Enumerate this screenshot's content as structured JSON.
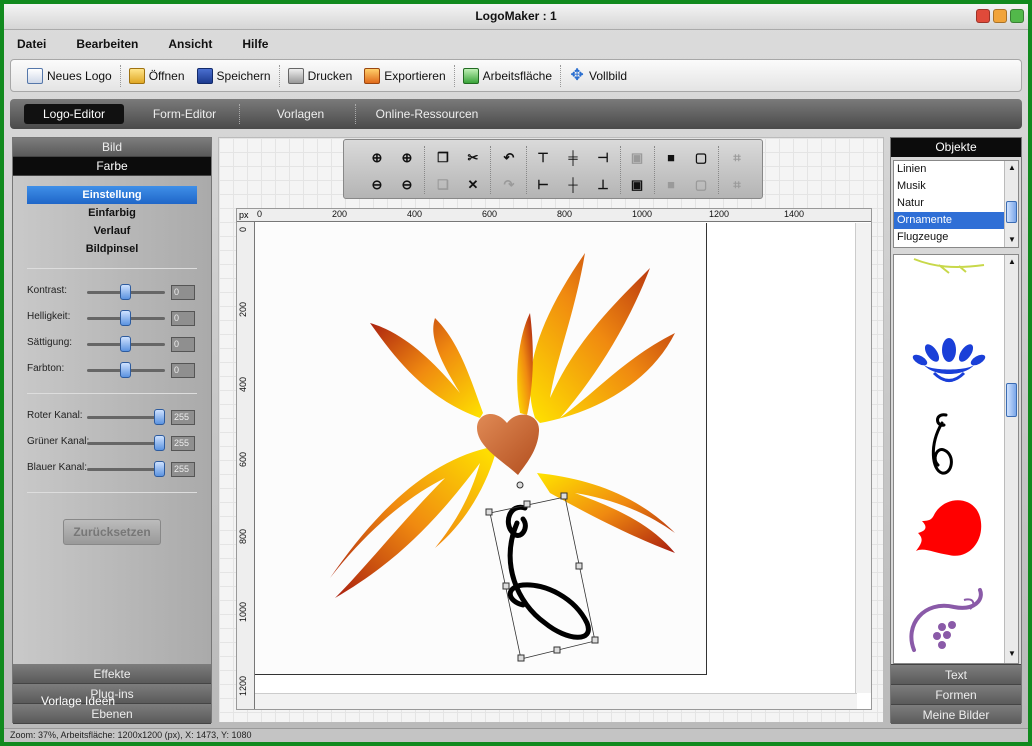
{
  "window": {
    "title": "LogoMaker : 1"
  },
  "menu": [
    "Datei",
    "Bearbeiten",
    "Ansicht",
    "Hilfe"
  ],
  "toolbar": {
    "new_logo": "Neues Logo",
    "open": "Öffnen",
    "save": "Speichern",
    "print": "Drucken",
    "export": "Exportieren",
    "workspace": "Arbeitsfläche",
    "fullscreen": "Vollbild"
  },
  "tabs": [
    "Logo-Editor",
    "Form-Editor",
    "Vorlagen",
    "Online-Ressourcen"
  ],
  "left_panel": {
    "bild": "Bild",
    "farbe": "Farbe",
    "modes": [
      "Einstellung",
      "Einfarbig",
      "Verlauf",
      "Bildpinsel"
    ],
    "adjust": [
      {
        "label": "Kontrast:",
        "value": "0"
      },
      {
        "label": "Helligkeit:",
        "value": "0"
      },
      {
        "label": "Sättigung:",
        "value": "0"
      },
      {
        "label": "Farbton:",
        "value": "0"
      }
    ],
    "channels": [
      {
        "label": "Roter Kanal:",
        "value": "255"
      },
      {
        "label": "Grüner Kanal:",
        "value": "255"
      },
      {
        "label": "Blauer Kanal:",
        "value": "255"
      }
    ],
    "reset": "Zurücksetzen",
    "effekte": "Effekte",
    "plugins": "Plug-ins",
    "ebenen": "Ebenen",
    "vorlage_ideen": "Vorlage Ideen"
  },
  "ruler": {
    "unit": "px",
    "h_labels": [
      "0",
      "200",
      "400",
      "600",
      "800",
      "1000",
      "1200",
      "1400"
    ],
    "v_labels": [
      "0",
      "200",
      "400",
      "600",
      "800",
      "1000",
      "1200"
    ]
  },
  "right_panel": {
    "objects": "Objekte",
    "categories": [
      "Linien",
      "Musik",
      "Natur",
      "Ornamente",
      "Flugzeuge"
    ],
    "selected_category": "Ornamente",
    "text": "Text",
    "formen": "Formen",
    "meine_bilder": "Meine Bilder"
  },
  "colors": {
    "accent": "#2f6fd6",
    "flame_light": "#ffe400",
    "flame_dark": "#a81d10"
  },
  "status": "Zoom: 37%, Arbeitsfläche: 1200x1200 (px), X: 1473, Y: 1080"
}
